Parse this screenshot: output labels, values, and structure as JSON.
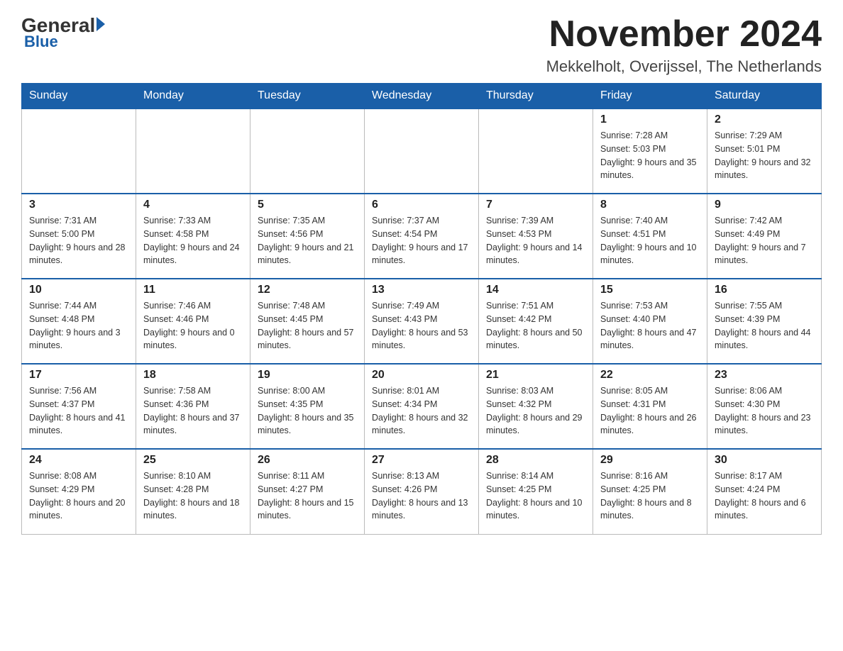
{
  "logo": {
    "general": "General",
    "blue": "Blue"
  },
  "header": {
    "month": "November 2024",
    "location": "Mekkelholt, Overijssel, The Netherlands"
  },
  "weekdays": [
    "Sunday",
    "Monday",
    "Tuesday",
    "Wednesday",
    "Thursday",
    "Friday",
    "Saturday"
  ],
  "weeks": [
    [
      {
        "day": "",
        "info": ""
      },
      {
        "day": "",
        "info": ""
      },
      {
        "day": "",
        "info": ""
      },
      {
        "day": "",
        "info": ""
      },
      {
        "day": "",
        "info": ""
      },
      {
        "day": "1",
        "info": "Sunrise: 7:28 AM\nSunset: 5:03 PM\nDaylight: 9 hours and 35 minutes."
      },
      {
        "day": "2",
        "info": "Sunrise: 7:29 AM\nSunset: 5:01 PM\nDaylight: 9 hours and 32 minutes."
      }
    ],
    [
      {
        "day": "3",
        "info": "Sunrise: 7:31 AM\nSunset: 5:00 PM\nDaylight: 9 hours and 28 minutes."
      },
      {
        "day": "4",
        "info": "Sunrise: 7:33 AM\nSunset: 4:58 PM\nDaylight: 9 hours and 24 minutes."
      },
      {
        "day": "5",
        "info": "Sunrise: 7:35 AM\nSunset: 4:56 PM\nDaylight: 9 hours and 21 minutes."
      },
      {
        "day": "6",
        "info": "Sunrise: 7:37 AM\nSunset: 4:54 PM\nDaylight: 9 hours and 17 minutes."
      },
      {
        "day": "7",
        "info": "Sunrise: 7:39 AM\nSunset: 4:53 PM\nDaylight: 9 hours and 14 minutes."
      },
      {
        "day": "8",
        "info": "Sunrise: 7:40 AM\nSunset: 4:51 PM\nDaylight: 9 hours and 10 minutes."
      },
      {
        "day": "9",
        "info": "Sunrise: 7:42 AM\nSunset: 4:49 PM\nDaylight: 9 hours and 7 minutes."
      }
    ],
    [
      {
        "day": "10",
        "info": "Sunrise: 7:44 AM\nSunset: 4:48 PM\nDaylight: 9 hours and 3 minutes."
      },
      {
        "day": "11",
        "info": "Sunrise: 7:46 AM\nSunset: 4:46 PM\nDaylight: 9 hours and 0 minutes."
      },
      {
        "day": "12",
        "info": "Sunrise: 7:48 AM\nSunset: 4:45 PM\nDaylight: 8 hours and 57 minutes."
      },
      {
        "day": "13",
        "info": "Sunrise: 7:49 AM\nSunset: 4:43 PM\nDaylight: 8 hours and 53 minutes."
      },
      {
        "day": "14",
        "info": "Sunrise: 7:51 AM\nSunset: 4:42 PM\nDaylight: 8 hours and 50 minutes."
      },
      {
        "day": "15",
        "info": "Sunrise: 7:53 AM\nSunset: 4:40 PM\nDaylight: 8 hours and 47 minutes."
      },
      {
        "day": "16",
        "info": "Sunrise: 7:55 AM\nSunset: 4:39 PM\nDaylight: 8 hours and 44 minutes."
      }
    ],
    [
      {
        "day": "17",
        "info": "Sunrise: 7:56 AM\nSunset: 4:37 PM\nDaylight: 8 hours and 41 minutes."
      },
      {
        "day": "18",
        "info": "Sunrise: 7:58 AM\nSunset: 4:36 PM\nDaylight: 8 hours and 37 minutes."
      },
      {
        "day": "19",
        "info": "Sunrise: 8:00 AM\nSunset: 4:35 PM\nDaylight: 8 hours and 35 minutes."
      },
      {
        "day": "20",
        "info": "Sunrise: 8:01 AM\nSunset: 4:34 PM\nDaylight: 8 hours and 32 minutes."
      },
      {
        "day": "21",
        "info": "Sunrise: 8:03 AM\nSunset: 4:32 PM\nDaylight: 8 hours and 29 minutes."
      },
      {
        "day": "22",
        "info": "Sunrise: 8:05 AM\nSunset: 4:31 PM\nDaylight: 8 hours and 26 minutes."
      },
      {
        "day": "23",
        "info": "Sunrise: 8:06 AM\nSunset: 4:30 PM\nDaylight: 8 hours and 23 minutes."
      }
    ],
    [
      {
        "day": "24",
        "info": "Sunrise: 8:08 AM\nSunset: 4:29 PM\nDaylight: 8 hours and 20 minutes."
      },
      {
        "day": "25",
        "info": "Sunrise: 8:10 AM\nSunset: 4:28 PM\nDaylight: 8 hours and 18 minutes."
      },
      {
        "day": "26",
        "info": "Sunrise: 8:11 AM\nSunset: 4:27 PM\nDaylight: 8 hours and 15 minutes."
      },
      {
        "day": "27",
        "info": "Sunrise: 8:13 AM\nSunset: 4:26 PM\nDaylight: 8 hours and 13 minutes."
      },
      {
        "day": "28",
        "info": "Sunrise: 8:14 AM\nSunset: 4:25 PM\nDaylight: 8 hours and 10 minutes."
      },
      {
        "day": "29",
        "info": "Sunrise: 8:16 AM\nSunset: 4:25 PM\nDaylight: 8 hours and 8 minutes."
      },
      {
        "day": "30",
        "info": "Sunrise: 8:17 AM\nSunset: 4:24 PM\nDaylight: 8 hours and 6 minutes."
      }
    ]
  ]
}
